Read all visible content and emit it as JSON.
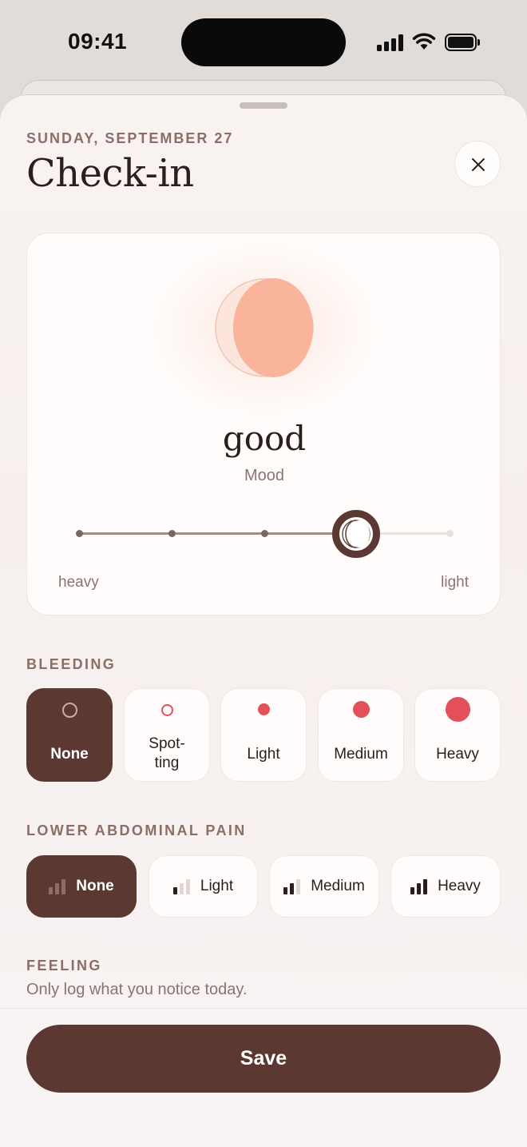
{
  "status_bar": {
    "time": "09:41"
  },
  "header": {
    "date": "SUNDAY, SEPTEMBER 27",
    "title": "Check-in"
  },
  "mood": {
    "value_word": "good",
    "label": "Mood",
    "scale_low": "heavy",
    "scale_high": "light",
    "slider_steps": 5,
    "slider_selected_step": 4,
    "icon": "moon-phase-icon"
  },
  "bleeding": {
    "label": "BLEEDING",
    "selected": "None",
    "options": [
      {
        "label": "None",
        "icon": "ring-dot-icon"
      },
      {
        "label": "Spot-\nting",
        "icon": "ring-dot-icon"
      },
      {
        "label": "Light",
        "icon": "small-dot-icon"
      },
      {
        "label": "Medium",
        "icon": "medium-dot-icon"
      },
      {
        "label": "Heavy",
        "icon": "large-dot-icon"
      }
    ]
  },
  "pain": {
    "label": "LOWER ABDOMINAL PAIN",
    "selected": "None",
    "options": [
      {
        "label": "None",
        "level": 0,
        "icon": "bars-icon"
      },
      {
        "label": "Light",
        "level": 1,
        "icon": "bars-icon"
      },
      {
        "label": "Medium",
        "level": 2,
        "icon": "bars-icon"
      },
      {
        "label": "Heavy",
        "level": 3,
        "icon": "bars-icon"
      }
    ]
  },
  "feeling": {
    "label": "FEELING",
    "subtitle": "Only log what you notice today."
  },
  "footer": {
    "save_label": "Save"
  },
  "colors": {
    "accent_dark": "#5b3932",
    "bleed_red": "#e4505a",
    "mood_peach": "#f9b49b",
    "muted_text": "#8a7470"
  }
}
